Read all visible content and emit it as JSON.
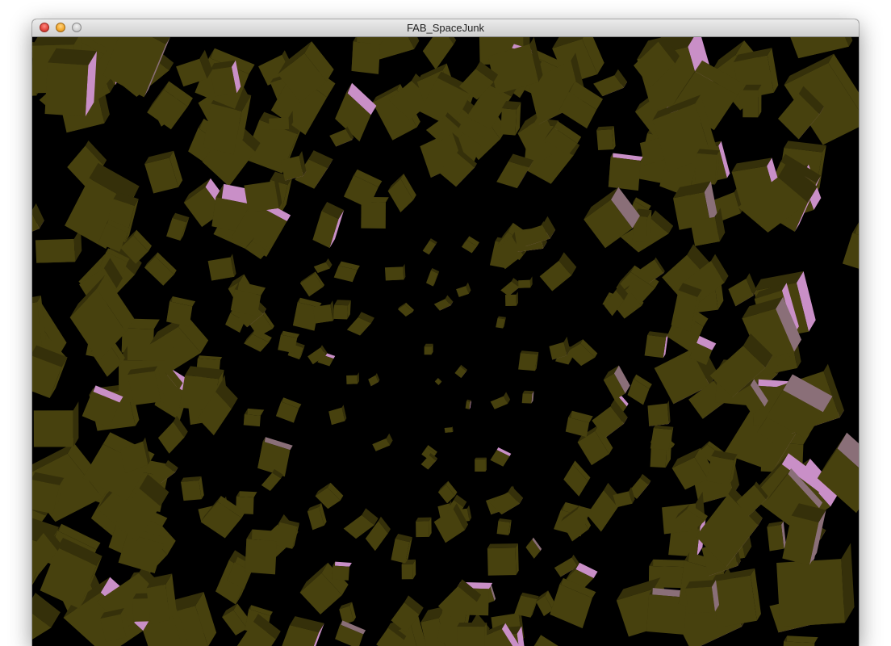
{
  "window": {
    "title": "FAB_SpaceJunk"
  },
  "colors": {
    "background": "#000000",
    "cube_olive": "#47410e",
    "cube_olive_dark": "#35300a",
    "cube_pink": "#c98fc7",
    "cube_mauve": "#8a6f78"
  }
}
